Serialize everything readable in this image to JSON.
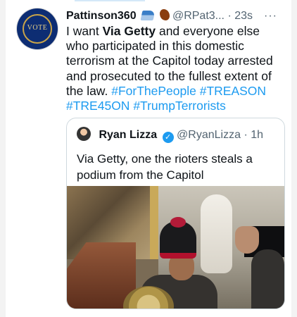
{
  "tweet": {
    "display_name": "Pattinson360",
    "handle": "@RPat3...",
    "dot": "·",
    "time": "23s",
    "more": "···",
    "avatar_text": "VOTE",
    "text_parts": {
      "intro": "I want ",
      "bold": "Via Getty",
      "body": " and everyone else who participated in this domestic terrorism at the Capitol today arrested and prosecuted to the fullest extent of the law. ",
      "hashtags": [
        "#ForThePeople",
        "#TREASON",
        "#TRE45ON",
        "#TrumpTerrorists"
      ]
    }
  },
  "quoted_tweet": {
    "display_name": "Ryan Lizza",
    "verified_symbol": "✓",
    "handle": "@RyanLizza",
    "dot": "·",
    "time": "1h",
    "text": "Via Getty, one the rioters steals a podium from the Capitol"
  },
  "colors": {
    "link_blue": "#1d9bf0",
    "text_dark": "#0f1419",
    "muted_gray": "#536471",
    "border": "#cfd9de"
  },
  "icons": {
    "avatar": "vote-seal-icon",
    "emoji_one": "wave-emoji-icon",
    "emoji_two": "rooster-emoji-icon",
    "verified": "verified-badge-icon",
    "more": "more-options-icon"
  }
}
